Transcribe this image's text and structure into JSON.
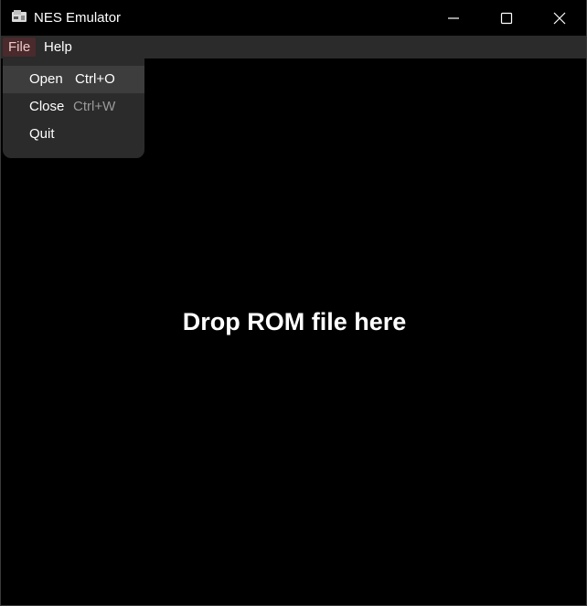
{
  "window": {
    "title": "NES Emulator"
  },
  "menubar": {
    "items": [
      {
        "label": "File"
      },
      {
        "label": "Help"
      }
    ]
  },
  "file_menu": {
    "items": [
      {
        "label": "Open",
        "shortcut": "Ctrl+O"
      },
      {
        "label": "Close",
        "shortcut": "Ctrl+W"
      },
      {
        "label": "Quit",
        "shortcut": ""
      }
    ]
  },
  "main": {
    "drop_hint": "Drop ROM file here"
  },
  "colors": {
    "background": "#000000",
    "menu_background": "#2b2b2b",
    "active_menu": "#4a2a2c",
    "hover_item": "#3d3d3d",
    "disabled_text": "#9a9a9a"
  },
  "icons": {
    "app": "nes-console-icon",
    "minimize": "minimize-icon",
    "maximize": "maximize-icon",
    "close": "close-icon"
  }
}
